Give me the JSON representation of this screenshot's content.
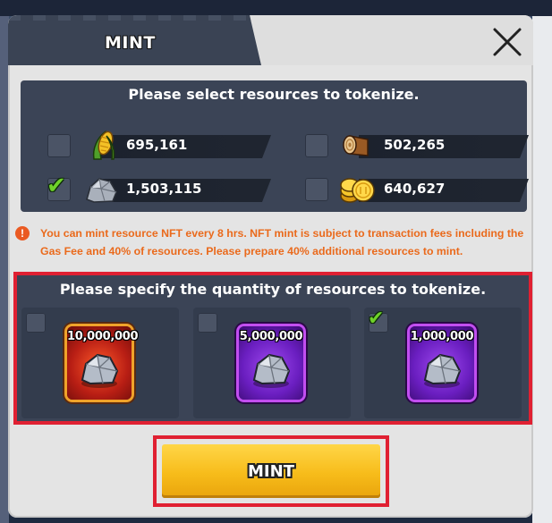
{
  "dialog": {
    "title": "MINT"
  },
  "resources": {
    "prompt": "Please select resources to tokenize.",
    "items": [
      {
        "name": "corn",
        "amount": "695,161",
        "checked": false
      },
      {
        "name": "wood",
        "amount": "502,265",
        "checked": false
      },
      {
        "name": "stone",
        "amount": "1,503,115",
        "checked": true
      },
      {
        "name": "gold",
        "amount": "640,627",
        "checked": false
      }
    ]
  },
  "notice": {
    "text": "You can mint resource NFT every 8 hrs. NFT mint is subject to transaction fees including the Gas Fee and 40% of resources. Please prepare 40% additional resources to mint."
  },
  "quantity": {
    "prompt": "Please specify the quantity of resources to tokenize.",
    "options": [
      {
        "label": "10,000,000",
        "frame": "orange",
        "checked": false
      },
      {
        "label": "5,000,000",
        "frame": "purple",
        "checked": false
      },
      {
        "label": "1,000,000",
        "frame": "purple",
        "checked": true
      }
    ]
  },
  "actions": {
    "mint_label": "MINT"
  },
  "colors": {
    "accent": "#f7bc1a",
    "warning": "#ea6a1c",
    "highlight": "#e02032",
    "check": "#6fd12a"
  }
}
